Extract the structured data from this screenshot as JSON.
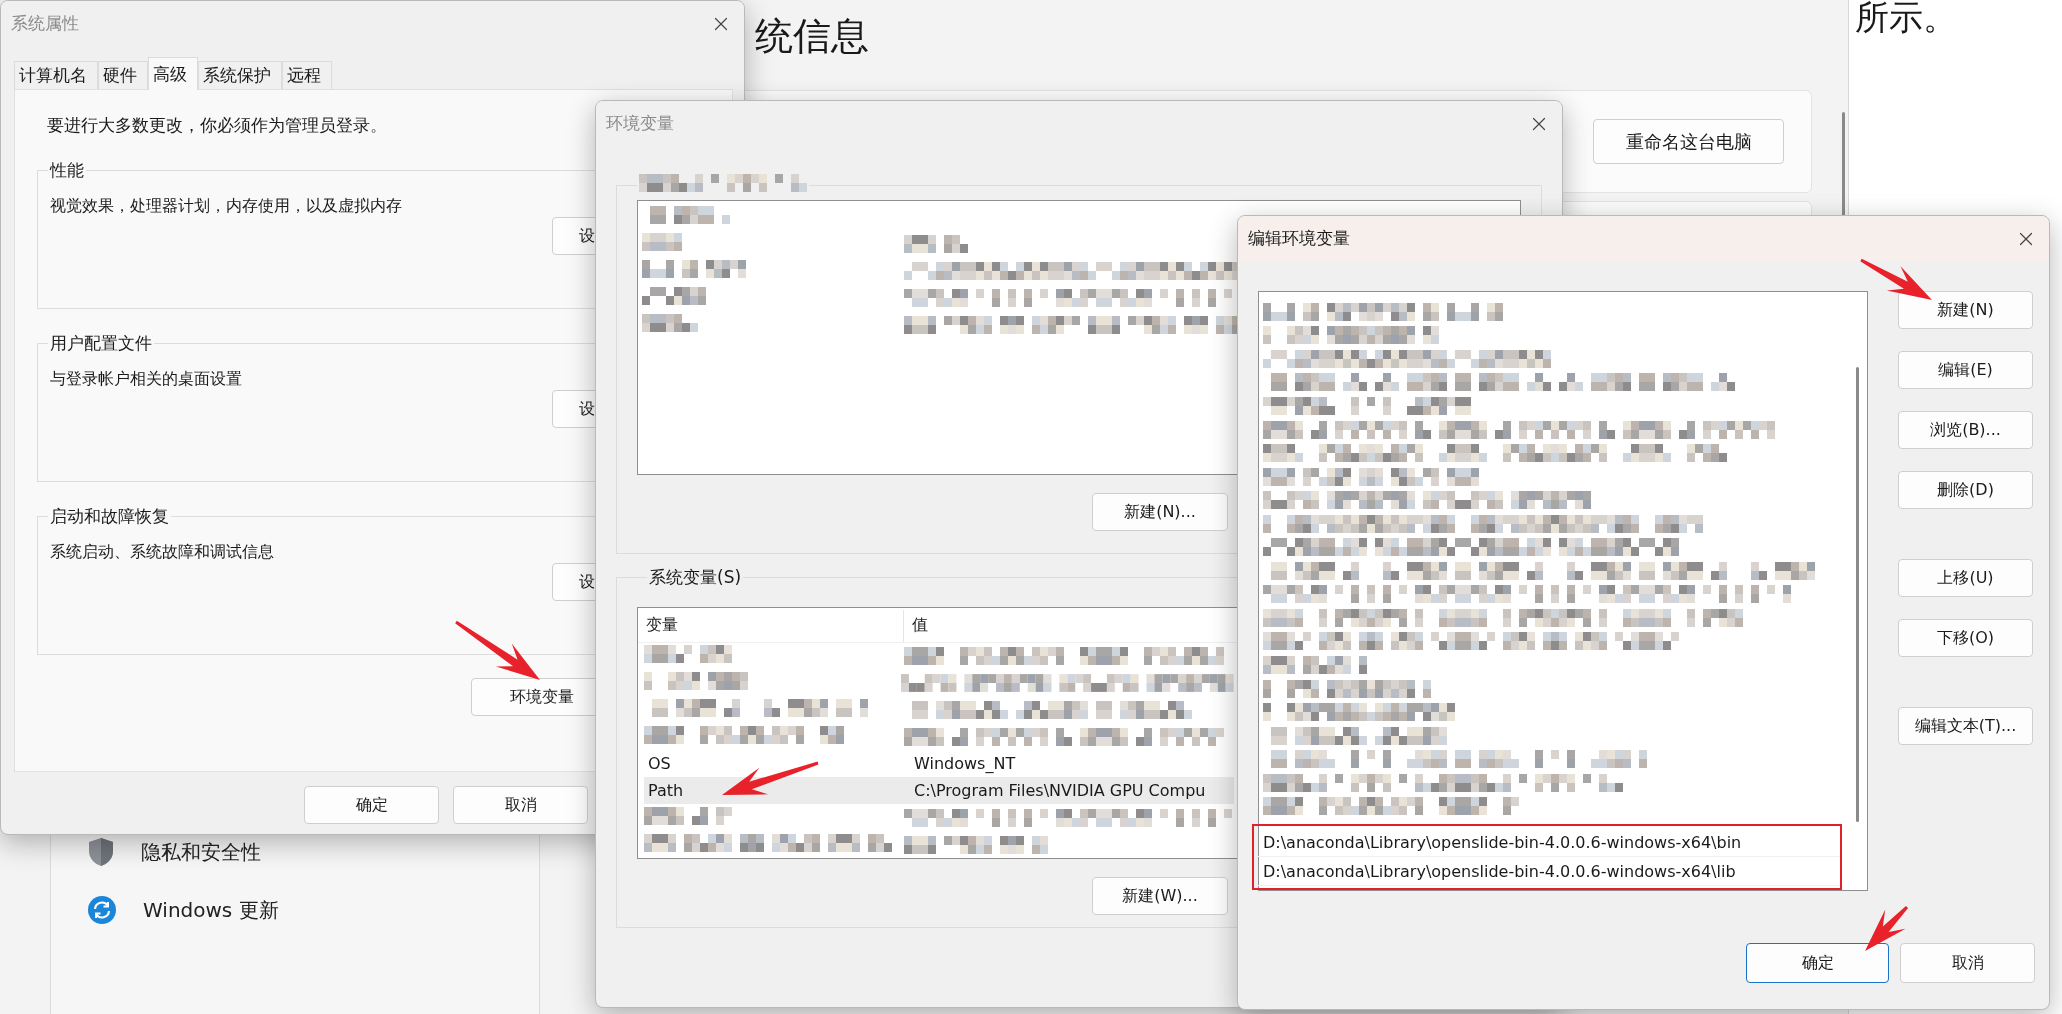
{
  "background": {
    "heading": "统信息",
    "doc_text": "所示。",
    "rename_button": "重命名这台电脑",
    "nav": [
      {
        "kind": "shield",
        "label": "隐私和安全性"
      },
      {
        "kind": "update",
        "label": "Windows 更新"
      }
    ]
  },
  "system_properties": {
    "title": "系统属性",
    "active": false,
    "tabs": [
      {
        "label": "计算机名",
        "selected": false
      },
      {
        "label": "硬件",
        "selected": false
      },
      {
        "label": "高级",
        "selected": true
      },
      {
        "label": "系统保护",
        "selected": false
      },
      {
        "label": "远程",
        "selected": false
      }
    ],
    "notice": "要进行大多数更改，你必须作为管理员登录。",
    "groups": [
      {
        "title": "性能",
        "description": "视觉效果，处理器计划，内存使用，以及虚拟内存",
        "button": "设"
      },
      {
        "title": "用户配置文件",
        "description": "与登录帐户相关的桌面设置",
        "button": "设"
      },
      {
        "title": "启动和故障恢复",
        "description": "系统启动、系统故障和调试信息",
        "button": "设"
      }
    ],
    "env_button": "环境变量",
    "buttons": [
      "确定",
      "取消"
    ]
  },
  "environment_variables": {
    "title": "环境变量",
    "active": false,
    "user_section": {
      "rows": [
        {
          "kind": "redacted"
        },
        {
          "kind": "redacted"
        },
        {
          "kind": "redacted"
        },
        {
          "kind": "redacted"
        },
        {
          "kind": "redacted"
        }
      ],
      "button": "新建(N)..."
    },
    "system_section": {
      "title": "系统变量(S)",
      "columns": [
        "变量",
        "值"
      ],
      "rows": [
        {
          "kind": "redacted",
          "selected": false
        },
        {
          "kind": "redacted",
          "selected": false
        },
        {
          "kind": "redacted",
          "selected": false
        },
        {
          "kind": "redacted",
          "selected": false
        },
        {
          "kind": "text",
          "name": "OS",
          "value": "Windows_NT",
          "selected": false
        },
        {
          "kind": "text",
          "name": "Path",
          "value": "C:\\Program Files\\NVIDIA GPU Compu",
          "selected": true
        },
        {
          "kind": "redacted",
          "selected": false
        },
        {
          "kind": "redacted",
          "selected": false
        }
      ],
      "button": "新建(W)..."
    }
  },
  "edit_environment_variable": {
    "title": "编辑环境变量",
    "active": true,
    "entries": [
      {
        "kind": "redacted"
      },
      {
        "kind": "redacted"
      },
      {
        "kind": "redacted"
      },
      {
        "kind": "redacted"
      },
      {
        "kind": "redacted"
      },
      {
        "kind": "redacted"
      },
      {
        "kind": "redacted"
      },
      {
        "kind": "redacted"
      },
      {
        "kind": "redacted"
      },
      {
        "kind": "redacted"
      },
      {
        "kind": "redacted"
      },
      {
        "kind": "redacted"
      },
      {
        "kind": "redacted"
      },
      {
        "kind": "redacted"
      },
      {
        "kind": "redacted"
      },
      {
        "kind": "redacted"
      },
      {
        "kind": "redacted"
      },
      {
        "kind": "redacted"
      },
      {
        "kind": "redacted"
      },
      {
        "kind": "redacted"
      },
      {
        "kind": "redacted"
      },
      {
        "kind": "redacted"
      }
    ],
    "highlighted_entries": [
      "D:\\anaconda\\Library\\openslide-bin-4.0.0.6-windows-x64\\bin",
      "D:\\anaconda\\Library\\openslide-bin-4.0.0.6-windows-x64\\lib"
    ],
    "side_button_groups": [
      [
        "新建(N)",
        "编辑(E)",
        "浏览(B)...",
        "删除(D)"
      ],
      [
        "上移(U)",
        "下移(O)"
      ],
      [
        "编辑文本(T)..."
      ]
    ],
    "buttons": [
      {
        "label": "确定",
        "default": true
      },
      {
        "label": "取消",
        "default": false
      }
    ]
  }
}
